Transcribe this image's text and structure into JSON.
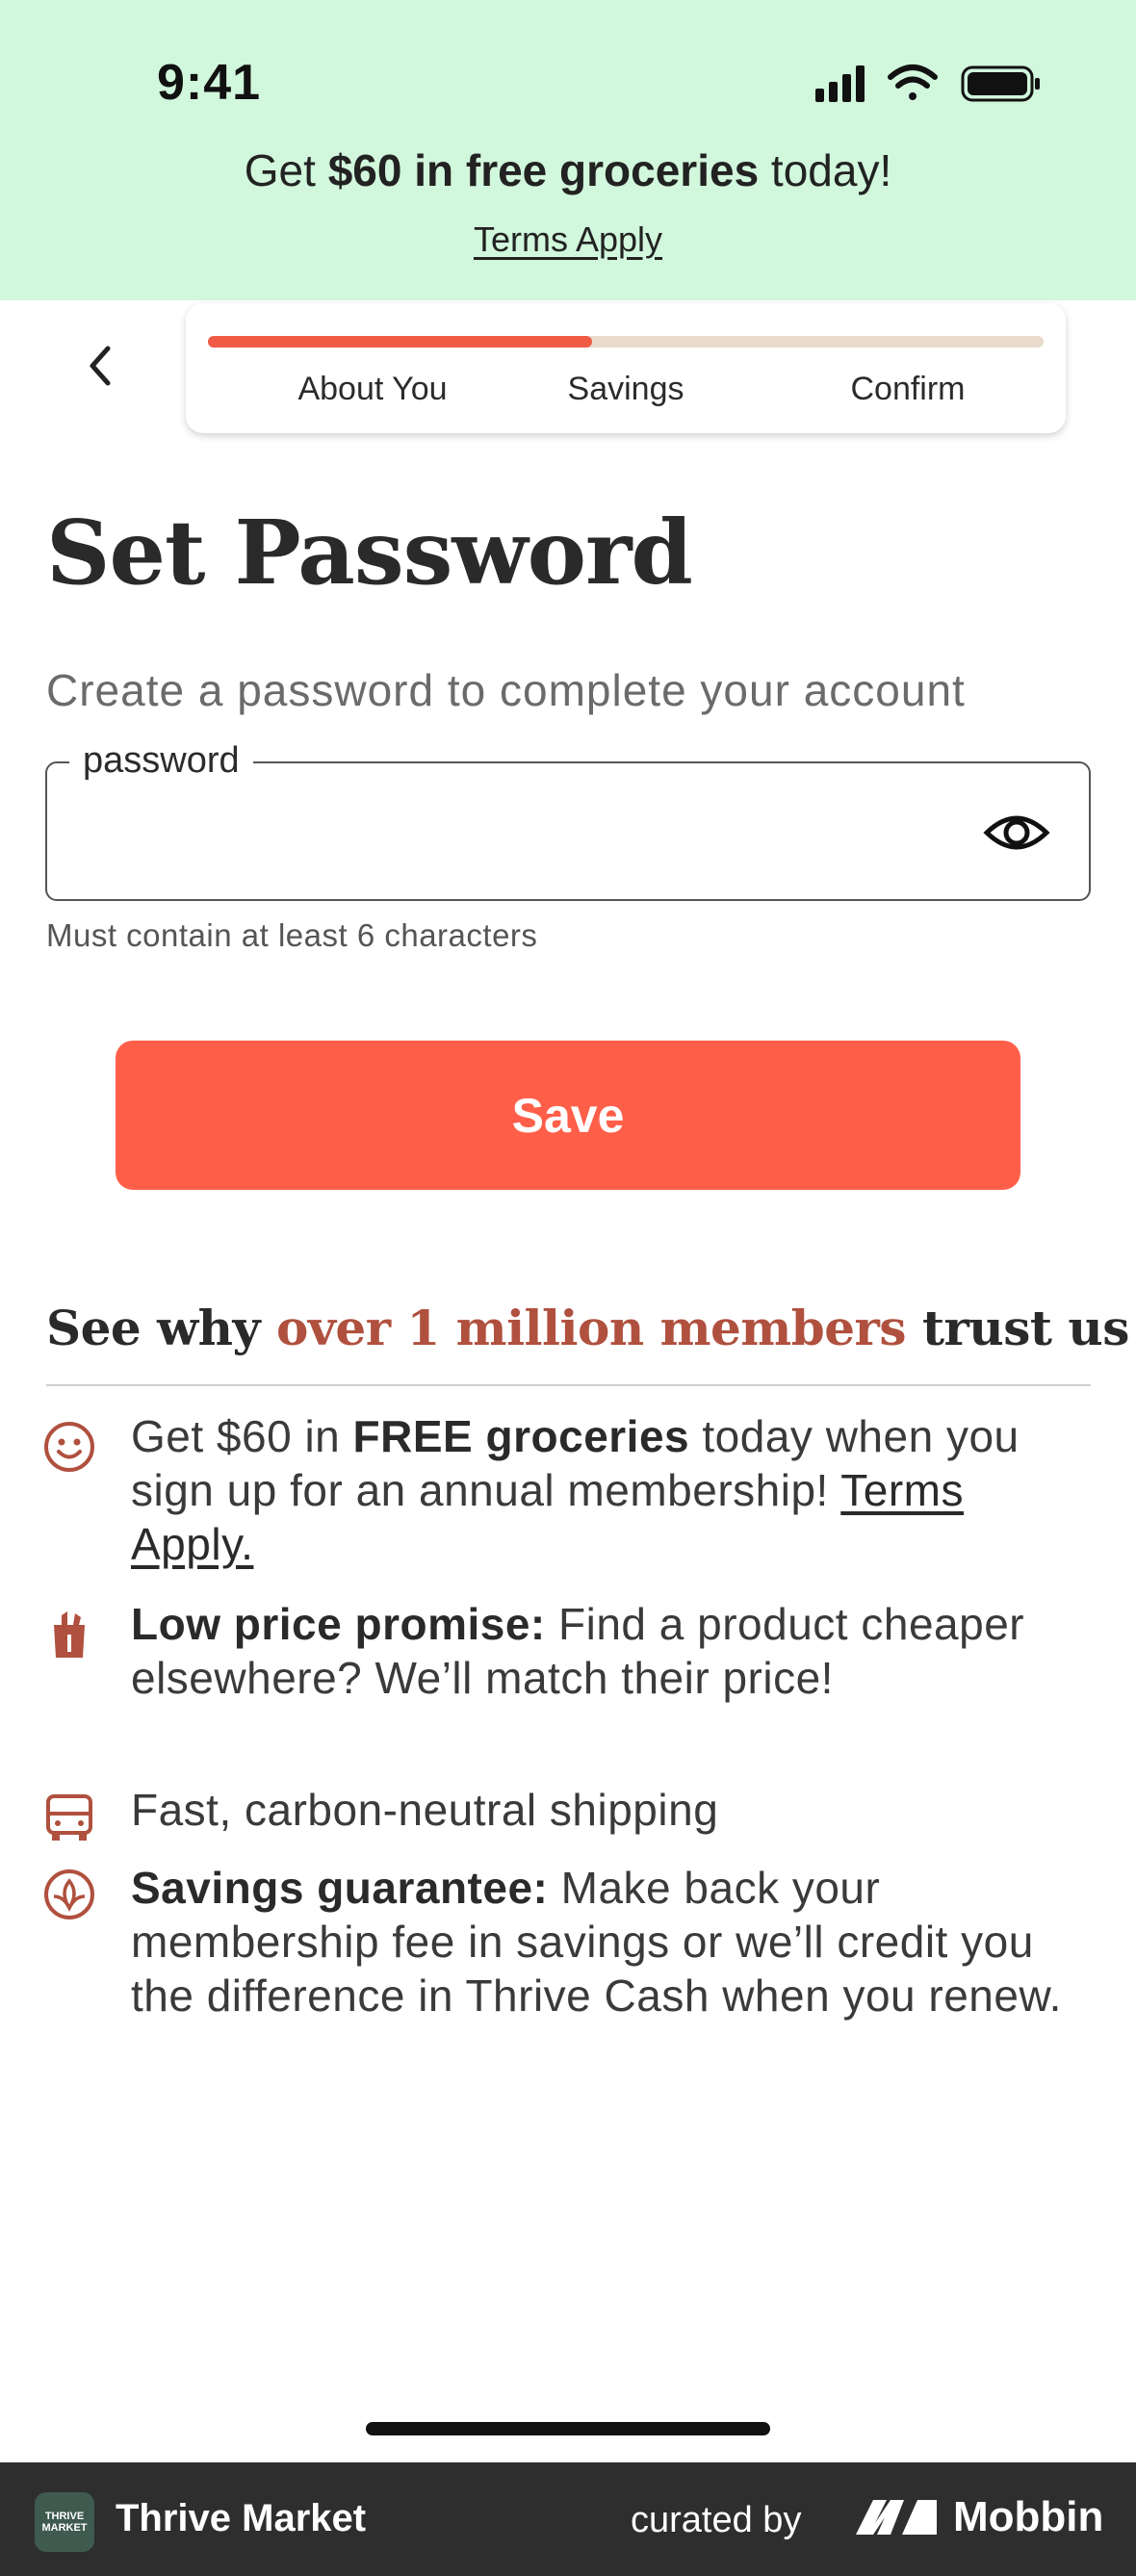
{
  "status_bar": {
    "time": "9:41"
  },
  "banner": {
    "prefix": "Get ",
    "highlight": "$60 in free groceries",
    "suffix": " today!",
    "terms": "Terms Apply"
  },
  "progress": {
    "fraction": 0.46,
    "steps": [
      "About You",
      "Savings",
      "Confirm"
    ]
  },
  "page": {
    "title": "Set Password",
    "subtitle": "Create a password to complete your account"
  },
  "password_field": {
    "label": "password",
    "value": "",
    "hint": "Must contain at least 6 characters"
  },
  "save_label": "Save",
  "trust": {
    "title_before": "See why ",
    "title_accent": "over 1 million members",
    "title_after": " trust us",
    "benefits": [
      {
        "icon": "smiley-icon",
        "part1": "Get $60 in ",
        "bold": "FREE groceries",
        "part2": " today when you sign up for an annual membership! ",
        "link": "Terms Apply."
      },
      {
        "icon": "grocery-bag-icon",
        "bold": "Low price promise:",
        "text": " Find a product cheaper elsewhere? We’ll match their price!"
      },
      {
        "icon": "truck-icon",
        "text": "Fast, carbon-neutral shipping"
      },
      {
        "icon": "savings-badge-icon",
        "bold": "Savings guarantee:",
        "text": " Make back your membership fee in savings or we’ll credit you the difference in Thrive Cash when you renew."
      }
    ]
  },
  "footer": {
    "app_logo_text": "THRIVE MARKET",
    "app_name": "Thrive Market",
    "curated_by": "curated by",
    "brand": "Mobbin"
  },
  "colors": {
    "banner_bg": "#d1f7dc",
    "accent": "#ff5f48",
    "progress_fill": "#ef5b45",
    "icon_red": "#b0503e"
  }
}
